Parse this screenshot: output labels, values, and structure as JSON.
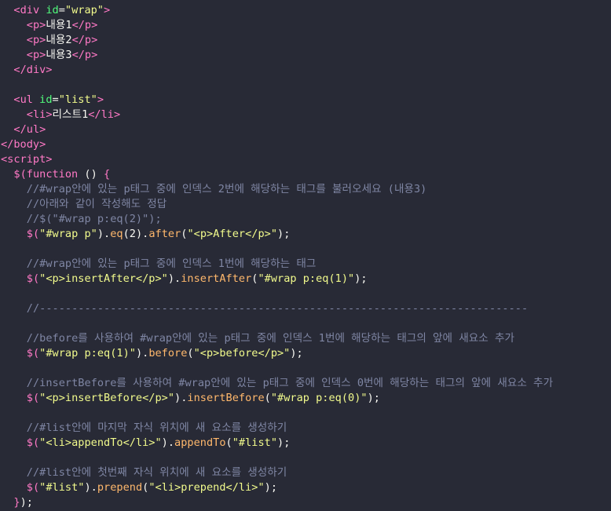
{
  "editor": {
    "background": "#282a36",
    "lines": [
      {
        "indent": 2,
        "tokens": [
          [
            "t",
            "<div"
          ],
          [
            "p",
            " "
          ],
          [
            "a",
            "id"
          ],
          [
            "p",
            "="
          ],
          [
            "s",
            "\"wrap\""
          ],
          [
            "t",
            ">"
          ]
        ]
      },
      {
        "indent": 4,
        "tokens": [
          [
            "t",
            "<p>"
          ],
          [
            "p",
            "내용1"
          ],
          [
            "t",
            "</p>"
          ]
        ]
      },
      {
        "indent": 4,
        "tokens": [
          [
            "t",
            "<p>"
          ],
          [
            "p",
            "내용2"
          ],
          [
            "t",
            "</p>"
          ]
        ]
      },
      {
        "indent": 4,
        "tokens": [
          [
            "t",
            "<p>"
          ],
          [
            "p",
            "내용3"
          ],
          [
            "t",
            "</p>"
          ]
        ]
      },
      {
        "indent": 2,
        "tokens": [
          [
            "t",
            "</div>"
          ]
        ]
      },
      {
        "indent": 0,
        "tokens": []
      },
      {
        "indent": 2,
        "tokens": [
          [
            "t",
            "<ul"
          ],
          [
            "p",
            " "
          ],
          [
            "a",
            "id"
          ],
          [
            "p",
            "="
          ],
          [
            "s",
            "\"list\""
          ],
          [
            "t",
            ">"
          ]
        ]
      },
      {
        "indent": 4,
        "tokens": [
          [
            "t",
            "<li>"
          ],
          [
            "p",
            "리스트1"
          ],
          [
            "t",
            "</li>"
          ]
        ]
      },
      {
        "indent": 2,
        "tokens": [
          [
            "t",
            "</ul>"
          ]
        ]
      },
      {
        "indent": 0,
        "tokens": [
          [
            "t",
            "</body>"
          ]
        ]
      },
      {
        "indent": 0,
        "tokens": [
          [
            "t",
            "<script>"
          ]
        ]
      },
      {
        "indent": 2,
        "tokens": [
          [
            "t",
            "$("
          ],
          [
            "t",
            "function"
          ],
          [
            "p",
            " () "
          ],
          [
            "t",
            "{"
          ]
        ]
      },
      {
        "indent": 4,
        "tokens": [
          [
            "c",
            "//#wrap안에 있는 p태그 중에 인덱스 2번에 해당하는 태그를 불러오세요 (내용3)"
          ]
        ]
      },
      {
        "indent": 4,
        "tokens": [
          [
            "c",
            "//아래와 같이 작성해도 정답"
          ]
        ]
      },
      {
        "indent": 4,
        "tokens": [
          [
            "c",
            "//$(\"#wrap p:eq(2)\");"
          ]
        ]
      },
      {
        "indent": 4,
        "tokens": [
          [
            "t",
            "$("
          ],
          [
            "s",
            "\"#wrap p\""
          ],
          [
            "p",
            ")."
          ],
          [
            "f",
            "eq"
          ],
          [
            "p",
            "(2)."
          ],
          [
            "f",
            "after"
          ],
          [
            "p",
            "("
          ],
          [
            "s",
            "\"<p>After</p>\""
          ],
          [
            "p",
            ");"
          ]
        ]
      },
      {
        "indent": 0,
        "tokens": []
      },
      {
        "indent": 4,
        "tokens": [
          [
            "c",
            "//#wrap안에 있는 p태그 중에 인덱스 1번에 해당하는 태그"
          ]
        ]
      },
      {
        "indent": 4,
        "tokens": [
          [
            "t",
            "$("
          ],
          [
            "s",
            "\"<p>insertAfter</p>\""
          ],
          [
            "p",
            ")."
          ],
          [
            "f",
            "insertAfter"
          ],
          [
            "p",
            "("
          ],
          [
            "s",
            "\"#wrap p:eq(1)\""
          ],
          [
            "p",
            ");"
          ]
        ]
      },
      {
        "indent": 0,
        "tokens": []
      },
      {
        "indent": 4,
        "tokens": [
          [
            "c",
            "//----------------------------------------------------------------------------"
          ]
        ]
      },
      {
        "indent": 0,
        "tokens": []
      },
      {
        "indent": 4,
        "tokens": [
          [
            "c",
            "//before를 사용하여 #wrap안에 있는 p태그 중에 인덱스 1번에 해당하는 태그의 앞에 새요소 추가"
          ]
        ]
      },
      {
        "indent": 4,
        "tokens": [
          [
            "t",
            "$("
          ],
          [
            "s",
            "\"#wrap p:eq(1)\""
          ],
          [
            "p",
            ")."
          ],
          [
            "f",
            "before"
          ],
          [
            "p",
            "("
          ],
          [
            "s",
            "\"<p>before</p>\""
          ],
          [
            "p",
            ");"
          ]
        ]
      },
      {
        "indent": 0,
        "tokens": []
      },
      {
        "indent": 4,
        "tokens": [
          [
            "c",
            "//insertBefore를 사용하여 #wrap안에 있는 p태그 중에 인덱스 0번에 해당하는 태그의 앞에 새요소 추가"
          ]
        ]
      },
      {
        "indent": 4,
        "tokens": [
          [
            "t",
            "$("
          ],
          [
            "s",
            "\"<p>insertBefore</p>\""
          ],
          [
            "p",
            ")."
          ],
          [
            "f",
            "insertBefore"
          ],
          [
            "p",
            "("
          ],
          [
            "s",
            "\"#wrap p:eq(0)\""
          ],
          [
            "p",
            ");"
          ]
        ]
      },
      {
        "indent": 0,
        "tokens": []
      },
      {
        "indent": 4,
        "tokens": [
          [
            "c",
            "//#list안에 마지막 자식 위치에 새 요소를 생성하기"
          ]
        ]
      },
      {
        "indent": 4,
        "tokens": [
          [
            "t",
            "$("
          ],
          [
            "s",
            "\"<li>appendTo</li>\""
          ],
          [
            "p",
            ")."
          ],
          [
            "f",
            "appendTo"
          ],
          [
            "p",
            "("
          ],
          [
            "s",
            "\"#list\""
          ],
          [
            "p",
            ");"
          ]
        ]
      },
      {
        "indent": 0,
        "tokens": []
      },
      {
        "indent": 4,
        "tokens": [
          [
            "c",
            "//#list안에 첫번째 자식 위치에 새 요소를 생성하기"
          ]
        ]
      },
      {
        "indent": 4,
        "tokens": [
          [
            "t",
            "$("
          ],
          [
            "s",
            "\"#list\""
          ],
          [
            "p",
            ")."
          ],
          [
            "f",
            "prepend"
          ],
          [
            "p",
            "("
          ],
          [
            "s",
            "\"<li>prepend</li>\""
          ],
          [
            "p",
            ");"
          ]
        ]
      },
      {
        "indent": 2,
        "tokens": [
          [
            "t",
            "}"
          ],
          [
            "p",
            ");"
          ]
        ]
      }
    ]
  }
}
